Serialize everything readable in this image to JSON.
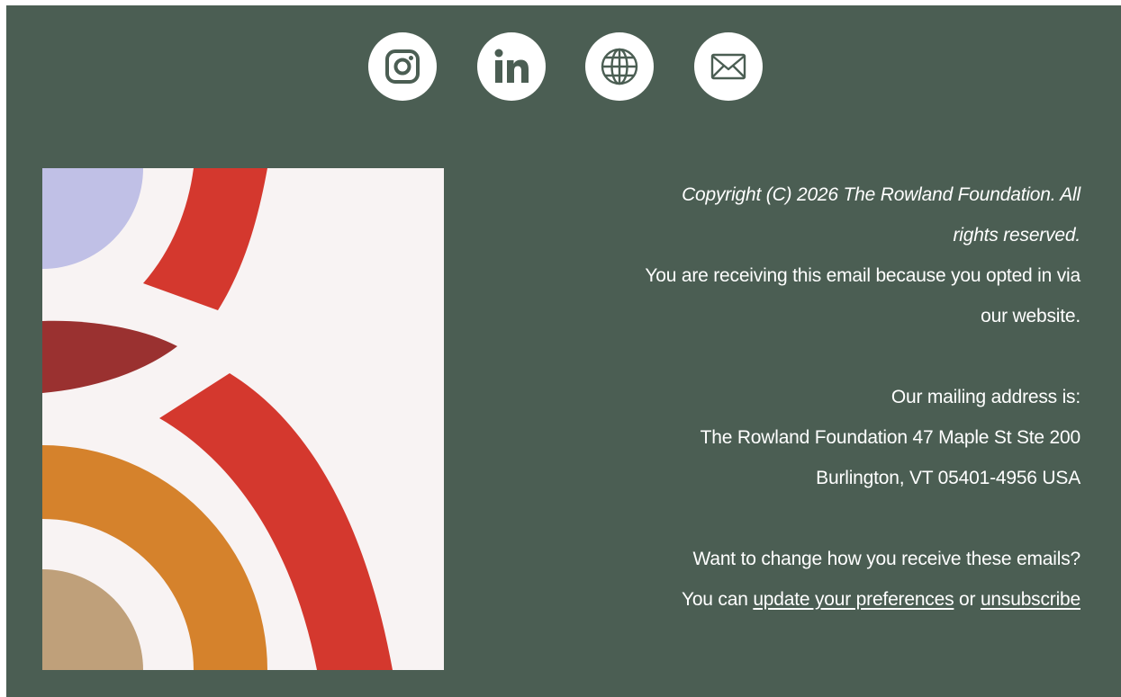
{
  "social": [
    {
      "name": "instagram",
      "icon": "instagram-icon"
    },
    {
      "name": "linkedin",
      "icon": "linkedin-icon"
    },
    {
      "name": "website",
      "icon": "globe-icon"
    },
    {
      "name": "email",
      "icon": "envelope-icon"
    }
  ],
  "copyright": {
    "line1": "Copyright (C) 2026 The Rowland Foundation. All",
    "line2": "rights reserved."
  },
  "reason": {
    "line1": "You are receiving this email because you opted in via",
    "line2": "our website."
  },
  "address": {
    "heading": "Our mailing address is:",
    "line1": "The Rowland Foundation 47 Maple St Ste 200",
    "line2": "Burlington, VT 05401-4956 USA"
  },
  "preferences": {
    "question": "Want to change how you receive these emails?",
    "prefix": "You can",
    "update_link": "update your preferences",
    "connector": "or",
    "unsubscribe_link": "unsubscribe"
  },
  "colors": {
    "background": "#4b5e53",
    "logo_cream": "#f8f3f3",
    "logo_lavender": "#c0c0e6",
    "logo_red": "#d4382e",
    "logo_dark_red": "#9a3130",
    "logo_orange": "#d5822c",
    "logo_tan": "#bfa07a"
  }
}
